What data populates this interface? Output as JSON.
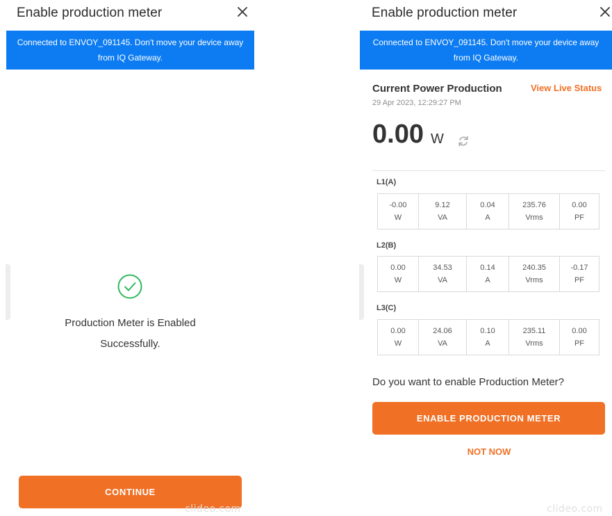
{
  "left": {
    "title": "Enable production meter",
    "banner": "Connected to ENVOY_091145. Don't move your device away from IQ Gateway.",
    "success_message": "Production Meter is Enabled Successfully.",
    "continue_label": "CONTINUE",
    "watermark": "clideo.com"
  },
  "right": {
    "title": "Enable production meter",
    "banner": "Connected to ENVOY_091145. Don't move your device away from IQ Gateway.",
    "current_power_title": "Current Power Production",
    "view_live_status": "View Live Status",
    "timestamp": "29 Apr 2023, 12:29:27 PM",
    "power_value": "0.00",
    "power_unit": "W",
    "phases": [
      {
        "label": "L1(A)",
        "cells": [
          {
            "value": "-0.00",
            "unit": "W"
          },
          {
            "value": "9.12",
            "unit": "VA"
          },
          {
            "value": "0.04",
            "unit": "A"
          },
          {
            "value": "235.76",
            "unit": "Vrms"
          },
          {
            "value": "0.00",
            "unit": "PF"
          }
        ]
      },
      {
        "label": "L2(B)",
        "cells": [
          {
            "value": "0.00",
            "unit": "W"
          },
          {
            "value": "34.53",
            "unit": "VA"
          },
          {
            "value": "0.14",
            "unit": "A"
          },
          {
            "value": "240.35",
            "unit": "Vrms"
          },
          {
            "value": "-0.17",
            "unit": "PF"
          }
        ]
      },
      {
        "label": "L3(C)",
        "cells": [
          {
            "value": "0.00",
            "unit": "W"
          },
          {
            "value": "24.06",
            "unit": "VA"
          },
          {
            "value": "0.10",
            "unit": "A"
          },
          {
            "value": "235.11",
            "unit": "Vrms"
          },
          {
            "value": "0.00",
            "unit": "PF"
          }
        ]
      }
    ],
    "question": "Do you want to enable Production Meter?",
    "enable_label": "ENABLE PRODUCTION METER",
    "not_now_label": "NOT NOW",
    "watermark": "clideo.com"
  },
  "colors": {
    "accent": "#f07025",
    "banner": "#0d7cf2",
    "success": "#2eb85c"
  },
  "icons": {
    "close": "close-icon",
    "success": "check-circle-icon",
    "refresh": "refresh-icon"
  }
}
